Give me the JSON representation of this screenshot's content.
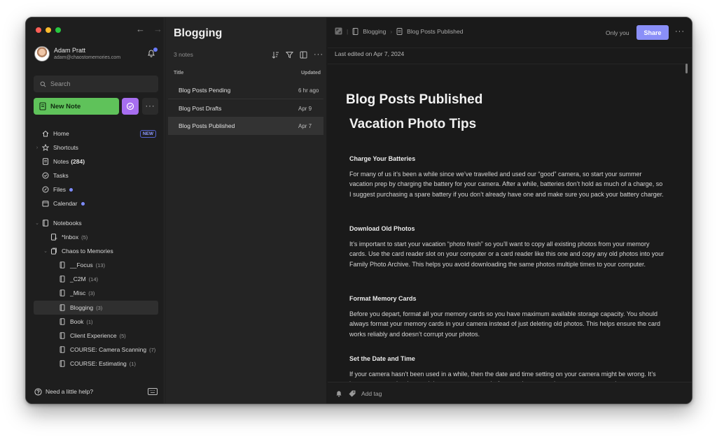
{
  "sidebar": {
    "user": {
      "name": "Adam Pratt",
      "email": "adam@chaostomemories.com"
    },
    "search_placeholder": "Search",
    "new_note_label": "New Note",
    "more_label": "···",
    "nav": [
      {
        "label": "Home",
        "badge": "NEW"
      },
      {
        "label": "Shortcuts"
      },
      {
        "label": "Notes",
        "count": "(284)"
      },
      {
        "label": "Tasks"
      },
      {
        "label": "Files"
      },
      {
        "label": "Calendar"
      }
    ],
    "notebooks_label": "Notebooks",
    "notebooks": [
      {
        "label": "*Inbox",
        "count": "(5)"
      },
      {
        "label": "Chaos to Memories"
      },
      {
        "label": "__Focus",
        "count": "(13)"
      },
      {
        "label": "_C2M",
        "count": "(14)"
      },
      {
        "label": "_Misc",
        "count": "(3)"
      },
      {
        "label": "Blogging",
        "count": "(3)"
      },
      {
        "label": "Book",
        "count": "(1)"
      },
      {
        "label": "Client Experience",
        "count": "(5)"
      },
      {
        "label": "COURSE: Camera Scanning",
        "count": "(7)"
      },
      {
        "label": "COURSE: Estimating",
        "count": "(1)"
      }
    ],
    "help_label": "Need a little help?"
  },
  "notelist": {
    "title": "Blogging",
    "count_label": "3 notes",
    "col_title": "Title",
    "col_updated": "Updated",
    "notes": [
      {
        "title": "Blog Posts Pending",
        "updated": "6 hr ago"
      },
      {
        "title": "Blog Post Drafts",
        "updated": "Apr 9"
      },
      {
        "title": "Blog Posts Published",
        "updated": "Apr 7"
      }
    ]
  },
  "editor": {
    "breadcrumb_notebook": "Blogging",
    "breadcrumb_note": "Blog Posts Published",
    "visibility": "Only you",
    "share_label": "Share",
    "more_label": "···",
    "last_edited": "Last edited on Apr 7, 2024",
    "doc_title": "Blog Posts Published",
    "heading": "Vacation Photo Tips",
    "sections": [
      {
        "title": "Charge Your Batteries",
        "body": "For many of us it’s been a while since we’ve travelled and used our “good” camera, so start your summer vacation prep by charging the battery for your camera. After a while, batteries don’t hold as much of a charge, so I suggest purchasing a spare battery if you don’t already have one and make sure you pack your battery charger."
      },
      {
        "title": "Download Old Photos",
        "body": "It’s important to start your vacation “photo fresh” so you’ll want to copy all existing photos from your memory cards. Use the card reader slot on your computer or a card reader like this one and copy any old photos into your Family Photo Archive. This helps you avoid downloading the same photos multiple times to your computer."
      },
      {
        "title": "Format Memory Cards",
        "body": "Before you depart, format all your memory cards so you have maximum available storage capacity. You should always format your memory cards in your camera instead of just deleting old photos. This helps ensure the card works reliably and doesn’t corrupt your photos."
      },
      {
        "title": "Set the Date and Time",
        "body": "If your camera hasn’t been used in a while, then the date and time setting on your camera might be wrong. It’s important to set the date and time on your camera before any important trip or event to ensure the capture details are correct and your photos are easy to organize. If you’re travelling"
      }
    ],
    "add_tag_label": "Add tag"
  },
  "colors": {
    "new_note_green": "#5fc25a",
    "task_purple": "#a76ef0",
    "share_blue": "#8a8ff8",
    "accent_dot": "#7d8bff"
  }
}
